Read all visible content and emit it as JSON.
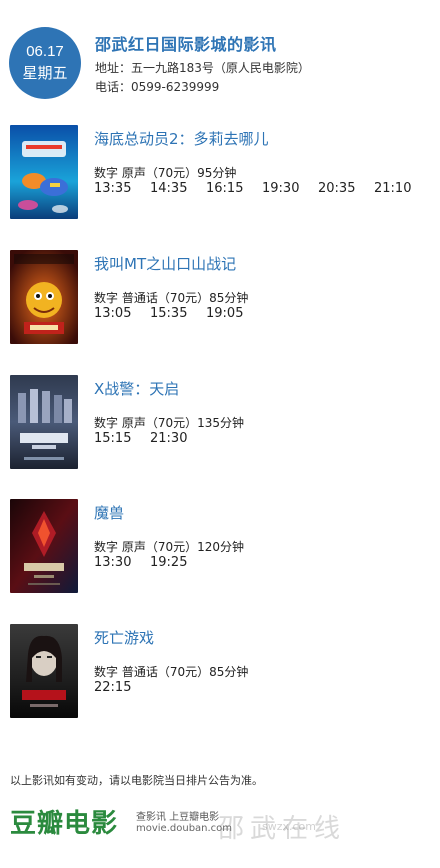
{
  "header": {
    "date": "06.17",
    "weekday": "星期五",
    "cinema_name": "邵武红日国际影城的影讯",
    "address": "地址：五一九路183号（原人民电影院）",
    "phone": "电话：0599-6239999"
  },
  "movies": [
    {
      "title": "海底总动员2：多莉去哪儿",
      "info": "数字  原声（70元）95分钟",
      "times": [
        "13:35",
        "14:35",
        "16:15",
        "19:30",
        "20:35",
        "21:10"
      ],
      "poster_icon": "finding-dory-poster"
    },
    {
      "title": "我叫MT之山口山战记",
      "info": "数字  普通话（70元）85分钟",
      "times": [
        "13:05",
        "15:35",
        "19:05"
      ],
      "poster_icon": "mt-poster"
    },
    {
      "title": "X战警：天启",
      "info": "数字  原声（70元）135分钟",
      "times": [
        "15:15",
        "21:30"
      ],
      "poster_icon": "x-men-poster"
    },
    {
      "title": "魔兽",
      "info": "数字  原声（70元）120分钟",
      "times": [
        "13:30",
        "19:25"
      ],
      "poster_icon": "warcraft-poster"
    },
    {
      "title": "死亡游戏",
      "info": "数字  普通话（70元）85分钟",
      "times": [
        "22:15"
      ],
      "poster_icon": "death-game-poster"
    }
  ],
  "footer": {
    "notice": "以上影讯如有变动，请以电影院当日排片公告为准。",
    "logo_text": "豆瓣电影",
    "tagline": "查影讯  上豆瓣电影",
    "url": "movie.douban.com",
    "watermark": "邵武在线",
    "watermark_url": "swzx.com"
  },
  "colors": {
    "accent": "#2e74b5",
    "douban_green": "#2b8a3e"
  }
}
